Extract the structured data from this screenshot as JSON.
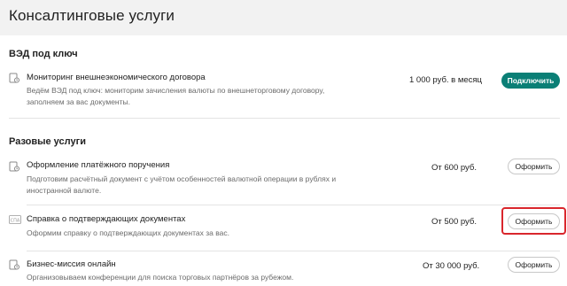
{
  "header": {
    "title": "Консалтинговые услуги"
  },
  "sections": [
    {
      "title": "ВЭД под ключ",
      "items": [
        {
          "icon": "document-clock-icon",
          "title": "Мониторинг внешнеэкономического договора",
          "description": "Ведём ВЭД под ключ: мониторим зачисления валюты по внешнеторговому договору, заполняем за вас документы.",
          "price": "1 000 руб. в месяц",
          "button": "Подключить"
        }
      ]
    },
    {
      "title": "Разовые услуги",
      "items": [
        {
          "icon": "document-clock-icon",
          "title": "Оформление платёжного поручения",
          "description": "Подготовим расчётный документ с учётом особенностей валютной операции в рублях и иностранной валюте.",
          "price": "От 600 руб.",
          "button": "Оформить"
        },
        {
          "icon": "spa-document-icon",
          "title": "Справка о подтверждающих документах",
          "description": "Оформим справку о подтверждающих документах за вас.",
          "price": "От 500 руб.",
          "button": "Оформить"
        },
        {
          "icon": "document-clock-icon",
          "title": "Бизнес-миссия онлайн",
          "description": "Организовываем конференции для поиска торговых партнёров за рубежом.",
          "price": "От 30 000 руб.",
          "button": "Оформить"
        }
      ]
    }
  ],
  "colors": {
    "accent": "#0b7f76",
    "highlight": "#d9262c"
  }
}
